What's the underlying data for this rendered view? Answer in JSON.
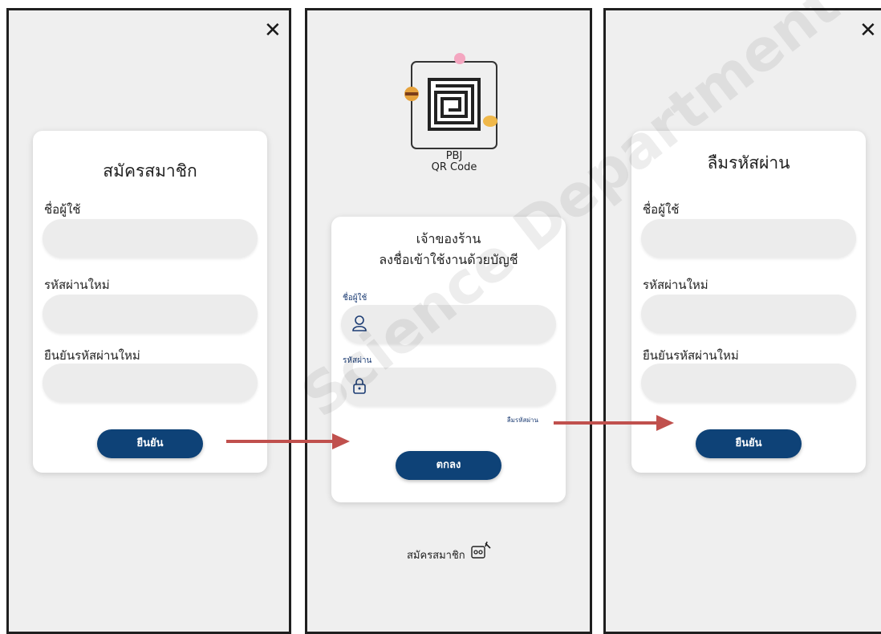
{
  "register_panel": {
    "title": "สมัครสมาชิก",
    "username_label": "ชื่อผู้ใช้",
    "password_label": "รหัสผ่านใหม่",
    "confirm_label": "ยืนยันรหัสผ่านใหม่",
    "confirm_button": "ยืนยัน",
    "close_icon": "✕"
  },
  "login_panel": {
    "logo_text_1": "PBJ",
    "logo_text_2": "QR Code",
    "heading_1": "เจ้าของร้าน",
    "heading_2": "ลงชื่อเข้าใช้งานด้วยบัญชี",
    "username_label": "ชื่อผู้ใช้",
    "password_label": "รหัสผ่าน",
    "forgot_link": "ลืมรหัสผ่าน",
    "ok_button": "ตกลง",
    "signup_link": "สมัครสมาชิก"
  },
  "forgot_panel": {
    "title": "ลืมรหัสผ่าน",
    "username_label": "ชื่อผู้ใช้",
    "password_label": "รหัสผ่านใหม่",
    "confirm_label": "ยืนยันรหัสผ่านใหม่",
    "confirm_button": "ยืนยัน",
    "close_icon": "✕"
  },
  "watermark": "Science Department Mahasarakham University",
  "colors": {
    "button": "#0e4277",
    "arrow": "#c0504d",
    "panel_bg": "#efefef"
  }
}
